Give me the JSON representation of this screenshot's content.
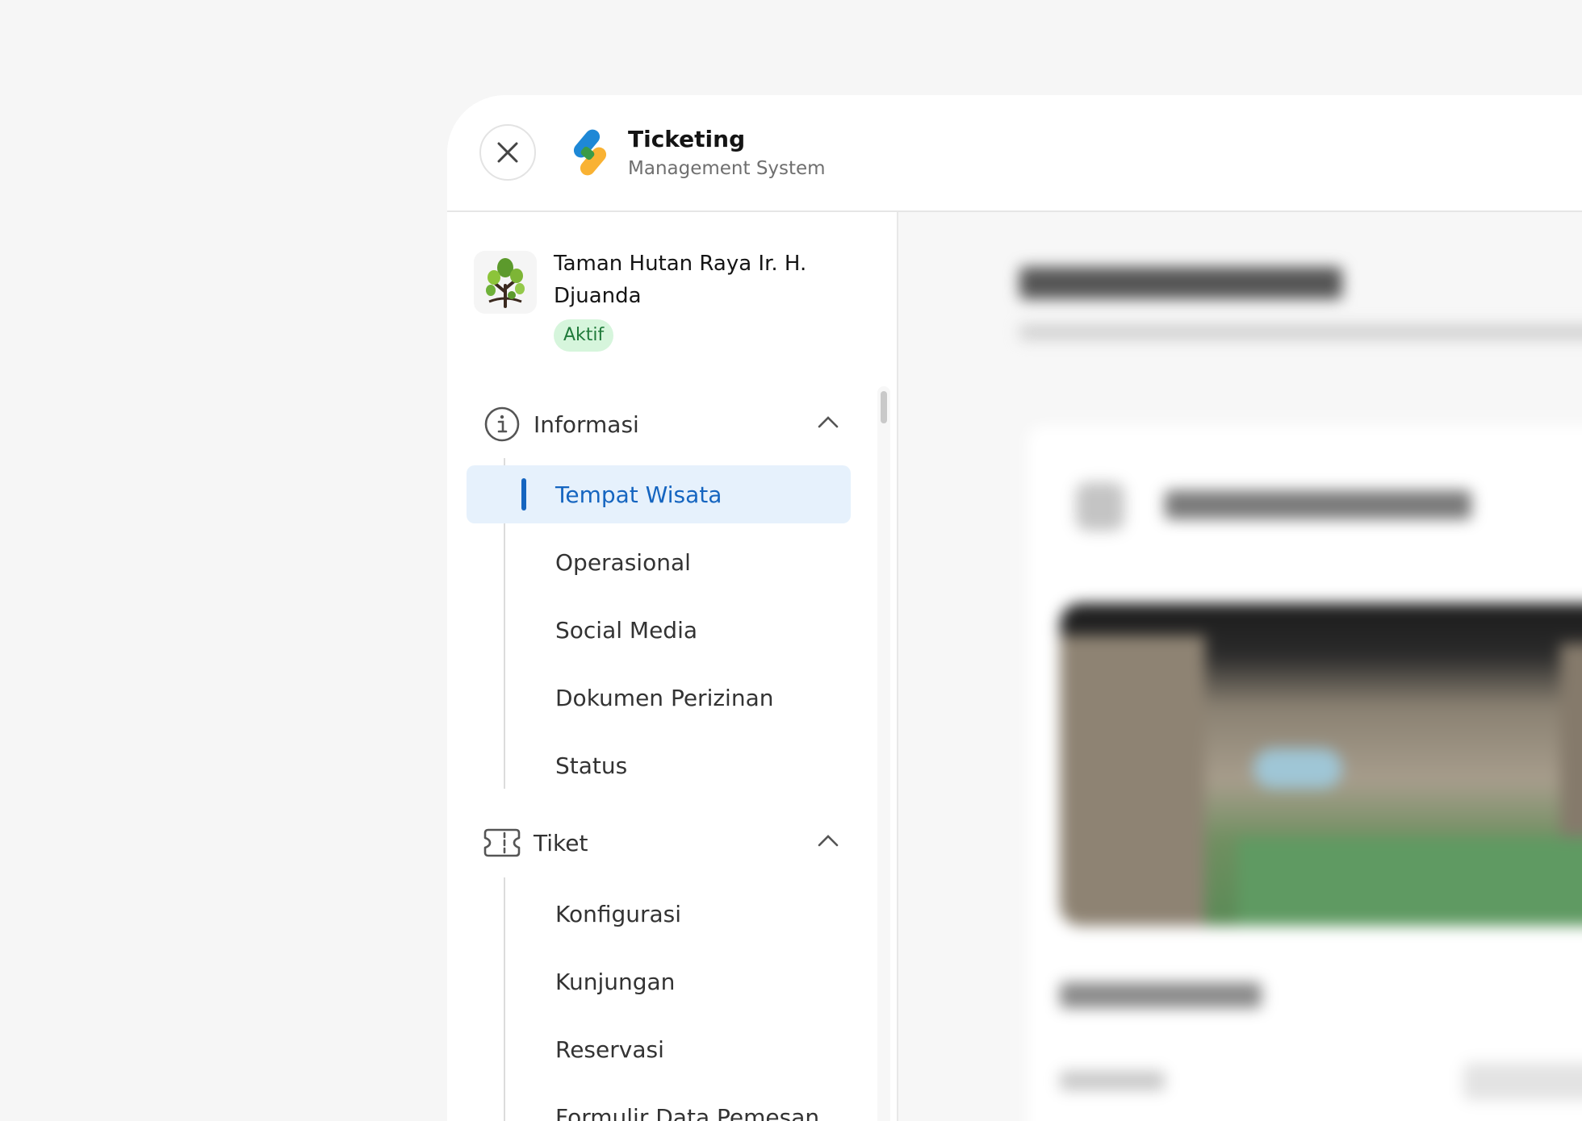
{
  "header": {
    "brand_title": "Ticketing",
    "brand_subtitle": "Management System"
  },
  "org": {
    "name": "Taman Hutan Raya Ir. H. Djuanda",
    "status": "Aktif"
  },
  "nav": {
    "groups": [
      {
        "label": "Informasi",
        "icon": "info-circle-icon",
        "expanded": true,
        "items": [
          "Tempat Wisata",
          "Operasional",
          "Social Media",
          "Dokumen Perizinan",
          "Status"
        ],
        "active_item": "Tempat Wisata"
      },
      {
        "label": "Tiket",
        "icon": "ticket-icon",
        "expanded": true,
        "items": [
          "Konfigurasi",
          "Kunjungan",
          "Reservasi",
          "Formulir Data Pemesan"
        ]
      }
    ]
  },
  "colors": {
    "accent": "#1565c0",
    "active_bg": "#e6f1fc",
    "badge_bg": "#d6f5dc",
    "badge_text": "#1f7a3a",
    "logo_blue": "#1e88d6",
    "logo_yellow": "#f9b233",
    "logo_green": "#3a9b48"
  }
}
